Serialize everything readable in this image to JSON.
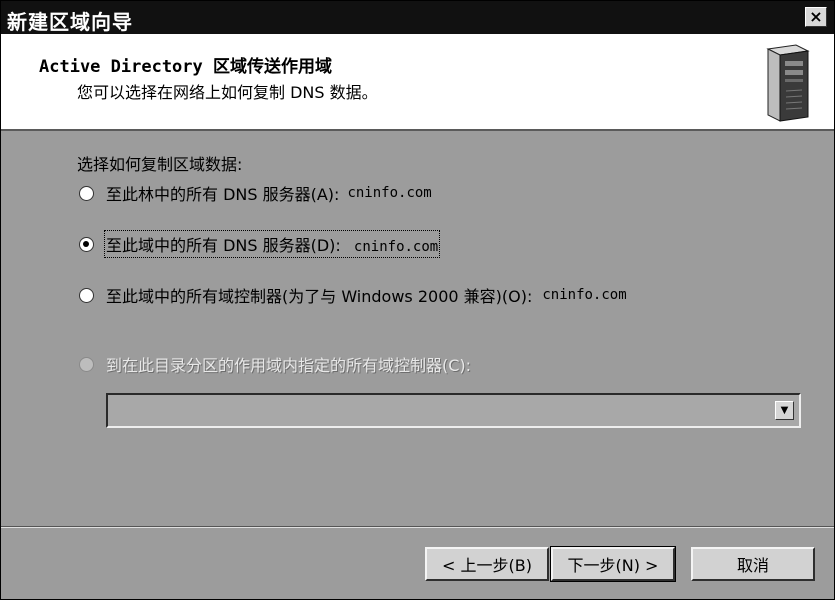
{
  "window": {
    "title": "新建区域向导",
    "close_label": "×"
  },
  "header": {
    "title": "Active Directory 区域传送作用域",
    "subtitle": "您可以选择在网络上如何复制 DNS 数据。",
    "icon": "server-icon"
  },
  "prompt": "选择如何复制区域数据:",
  "options": [
    {
      "label": "至此林中的所有 DNS 服务器(A):",
      "value": "cninfo.com",
      "checked": false,
      "enabled": true
    },
    {
      "label": "至此域中的所有 DNS 服务器(D):",
      "value": "cninfo.com",
      "checked": true,
      "enabled": true
    },
    {
      "label": "至此域中的所有域控制器(为了与 Windows 2000 兼容)(O):",
      "value": "cninfo.com",
      "checked": false,
      "enabled": true
    },
    {
      "label": "到在此目录分区的作用域内指定的所有域控制器(C):",
      "value": "",
      "checked": false,
      "enabled": false
    }
  ],
  "partition_dropdown": {
    "selected": ""
  },
  "buttons": {
    "back": "< 上一步(B)",
    "next": "下一步(N) >",
    "cancel": "取消"
  }
}
